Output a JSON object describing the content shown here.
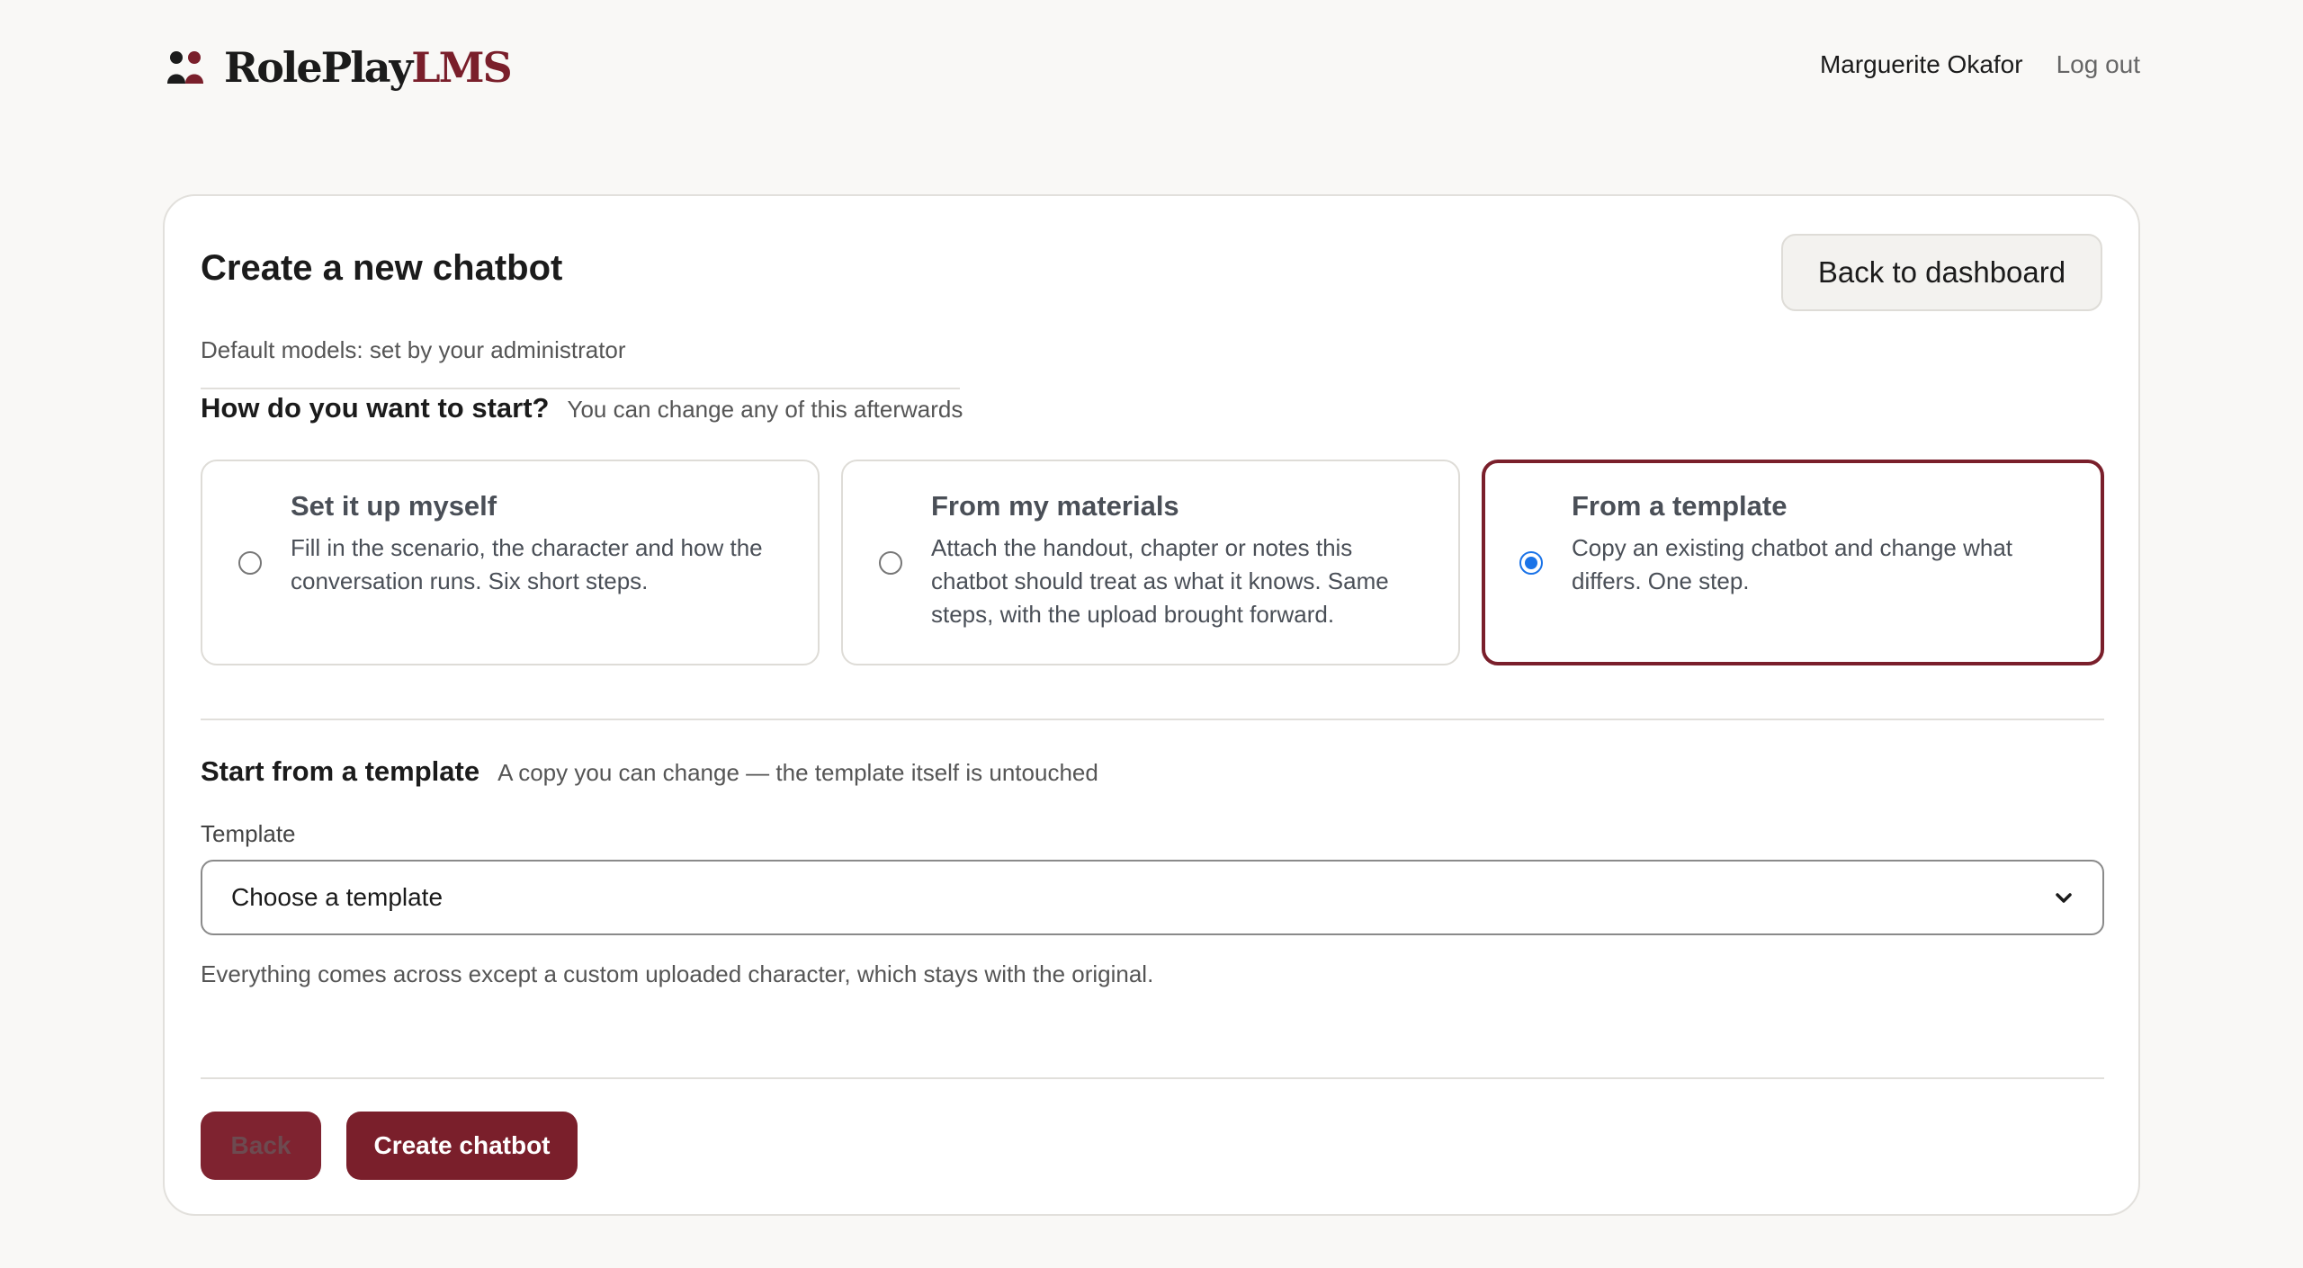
{
  "brand": {
    "name_main": "RolePlay",
    "name_accent": "LMS",
    "accent_color": "#7a1f2b"
  },
  "user_nav": {
    "user_name": "Marguerite Okafor",
    "logout_label": "Log out"
  },
  "page": {
    "title": "Create a new chatbot",
    "back_to_dashboard_label": "Back to dashboard",
    "default_models_text": "Default models: set by your administrator"
  },
  "start_section": {
    "heading": "How do you want to start?",
    "subheading": "You can change any of this afterwards",
    "options": [
      {
        "title": "Set it up myself",
        "description": "Fill in the scenario, the character and how the conversation runs. Six short steps.",
        "selected": false
      },
      {
        "title": "From my materials",
        "description": "Attach the handout, chapter or notes this chatbot should treat as what it knows. Same steps, with the upload brought forward.",
        "selected": false
      },
      {
        "title": "From a template",
        "description": "Copy an existing chatbot and change what differs. One step.",
        "selected": true
      }
    ]
  },
  "template_section": {
    "heading": "Start from a template",
    "subheading": "A copy you can change — the template itself is untouched",
    "field_label": "Template",
    "select_value": "Choose a template",
    "hint": "Everything comes across except a custom uploaded character, which stays with the original."
  },
  "actions": {
    "back_label": "Back",
    "create_label": "Create chatbot"
  }
}
